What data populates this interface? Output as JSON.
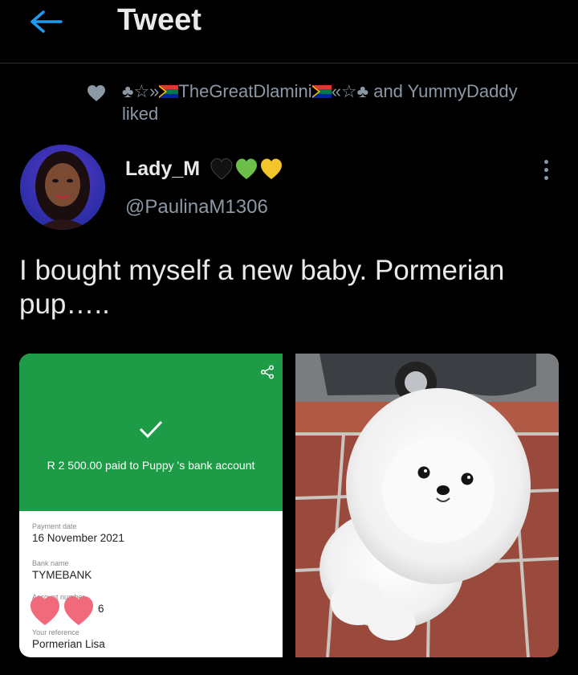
{
  "header": {
    "title": "Tweet"
  },
  "liked": {
    "prefix": "♣☆»",
    "name": "TheGreatDlamini",
    "suffix": "«☆♣",
    "connector": " and YummyDaddy",
    "line2": "liked"
  },
  "tweet": {
    "author_name": "Lady_M",
    "author_emojis": "🖤💚💛",
    "author_handle": "@PaulinaM1306",
    "text": "I bought myself a new baby. Pormerian pup….."
  },
  "receipt": {
    "paid_text": "R 2 500.00 paid to Puppy 's bank account",
    "payment_date_label": "Payment date",
    "payment_date": "16 November 2021",
    "bank_label": "Bank name",
    "bank_name": "TYMEBANK",
    "account_label": "Account number",
    "account_value": "6",
    "reference_label": "Your reference",
    "reference_value": "Pormerian Lisa"
  },
  "colors": {
    "accent": "#1d9bf0",
    "receipt_green": "#1e9b46",
    "muted": "#8b98a5"
  }
}
